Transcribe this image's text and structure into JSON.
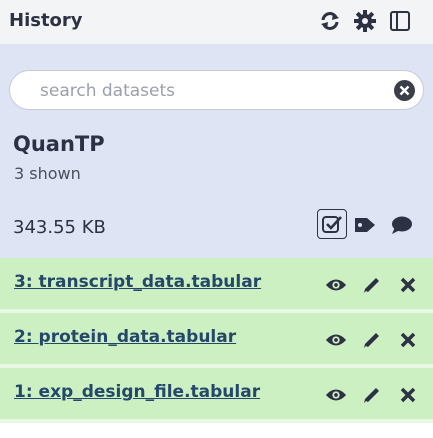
{
  "header": {
    "title": "History",
    "icons": [
      "refresh-icon",
      "gear-icon",
      "panel-toggle-icon"
    ]
  },
  "search": {
    "placeholder": "search datasets",
    "value": ""
  },
  "history": {
    "name": "QuanTP",
    "shown": "3 shown",
    "size": "343.55 KB",
    "summary_icons": [
      "select-all-icon",
      "tag-icon",
      "comment-icon"
    ]
  },
  "datasets": [
    {
      "title": "3: transcript_data.tabular",
      "state_color": "#ccf0c2"
    },
    {
      "title": "2: protein_data.tabular",
      "state_color": "#ccf0c2"
    },
    {
      "title": "1: exp_design_file.tabular",
      "state_color": "#ccf0c2"
    }
  ],
  "row_actions": [
    "eye-icon",
    "pencil-icon",
    "delete-icon"
  ],
  "colors": {
    "header_bg": "#f3f4f6",
    "panel_bg": "#dfe4f5",
    "ok_bg": "#ccf0c2",
    "link": "#25476a",
    "text": "#2c3143"
  }
}
